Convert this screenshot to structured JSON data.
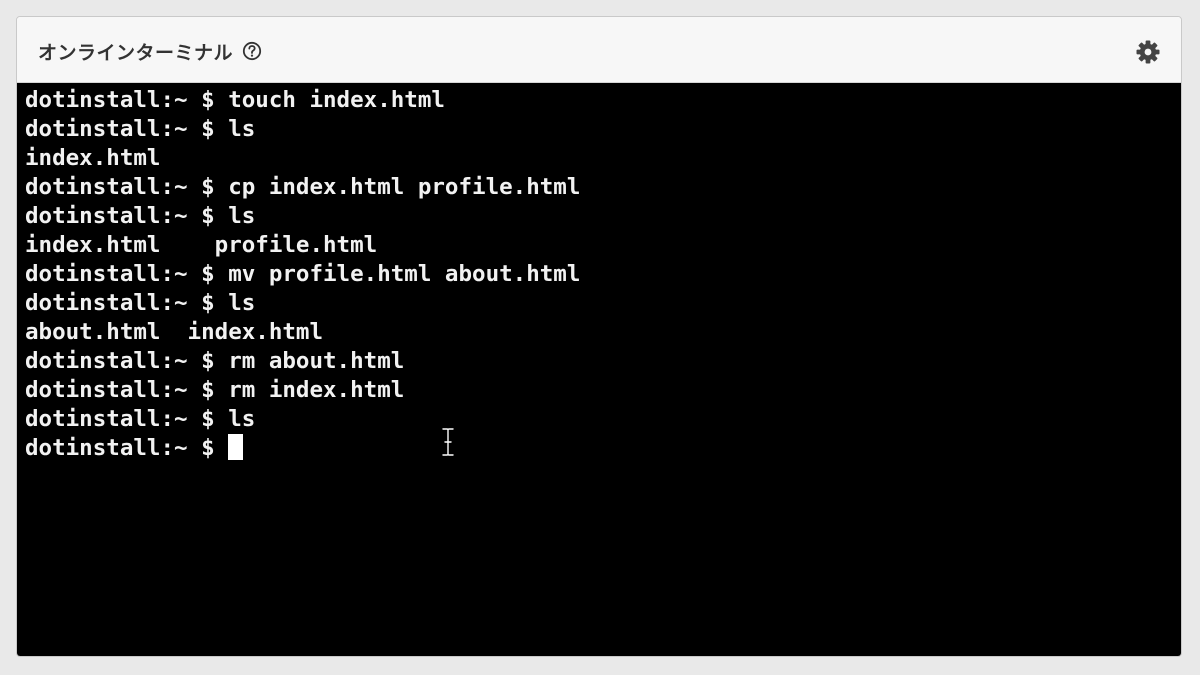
{
  "header": {
    "title": "オンラインターミナル",
    "help_icon": "question-circle-icon",
    "settings_icon": "gear-icon"
  },
  "terminal": {
    "lines": [
      "dotinstall:~ $ touch index.html",
      "dotinstall:~ $ ls",
      "index.html",
      "dotinstall:~ $ cp index.html profile.html",
      "dotinstall:~ $ ls",
      "index.html    profile.html",
      "dotinstall:~ $ mv profile.html about.html",
      "dotinstall:~ $ ls",
      "about.html  index.html",
      "dotinstall:~ $ rm about.html",
      "dotinstall:~ $ rm index.html",
      "dotinstall:~ $ ls"
    ],
    "prompt": "dotinstall:~ $ "
  },
  "colors": {
    "terminal_bg": "#000000",
    "terminal_fg": "#f2f2f2",
    "header_bg": "#f7f7f7",
    "title_text": "#333333"
  }
}
